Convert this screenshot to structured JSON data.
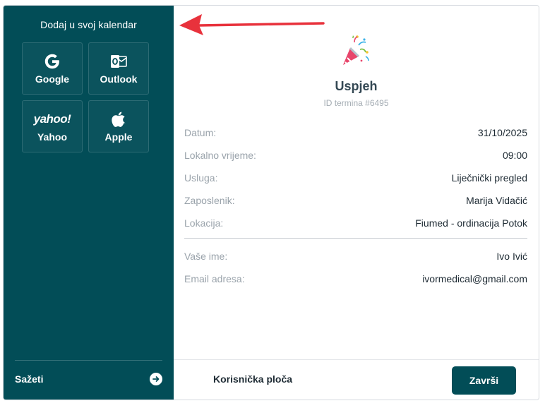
{
  "sidebar": {
    "title": "Dodaj u svoj kalendar",
    "calendars": {
      "google": {
        "label": "Google",
        "icon": "google-icon"
      },
      "outlook": {
        "label": "Outlook",
        "icon": "outlook-icon"
      },
      "yahoo": {
        "label": "Yahoo",
        "icon": "yahoo-icon",
        "logo_text": "yahoo!"
      },
      "apple": {
        "label": "Apple",
        "icon": "apple-icon"
      }
    },
    "summary_label": "Sažeti",
    "summary_icon": "arrow-right-circle-icon"
  },
  "main": {
    "icon": "party-popper-icon",
    "title": "Uspjeh",
    "subtitle": "ID termina #6495",
    "details": [
      {
        "key": "Datum:",
        "value": "31/10/2025"
      },
      {
        "key": "Lokalno vrijeme:",
        "value": "09:00"
      },
      {
        "key": "Usluga:",
        "value": "Liječnički pregled"
      },
      {
        "key": "Zaposlenik:",
        "value": "Marija Vidačić"
      },
      {
        "key": "Lokacija:",
        "value": "Fiumed - ordinacija Potok"
      }
    ],
    "customer": [
      {
        "key": "Vaše ime:",
        "value": "Ivo Ivić"
      },
      {
        "key": "Email adresa:",
        "value": "ivormedical@gmail.com"
      }
    ]
  },
  "footer": {
    "dashboard_label": "Korisnička ploča",
    "finish_label": "Završi"
  },
  "colors": {
    "sidebar_bg": "#024d57",
    "accent": "#024d57",
    "annotation_arrow": "#e8323c"
  }
}
